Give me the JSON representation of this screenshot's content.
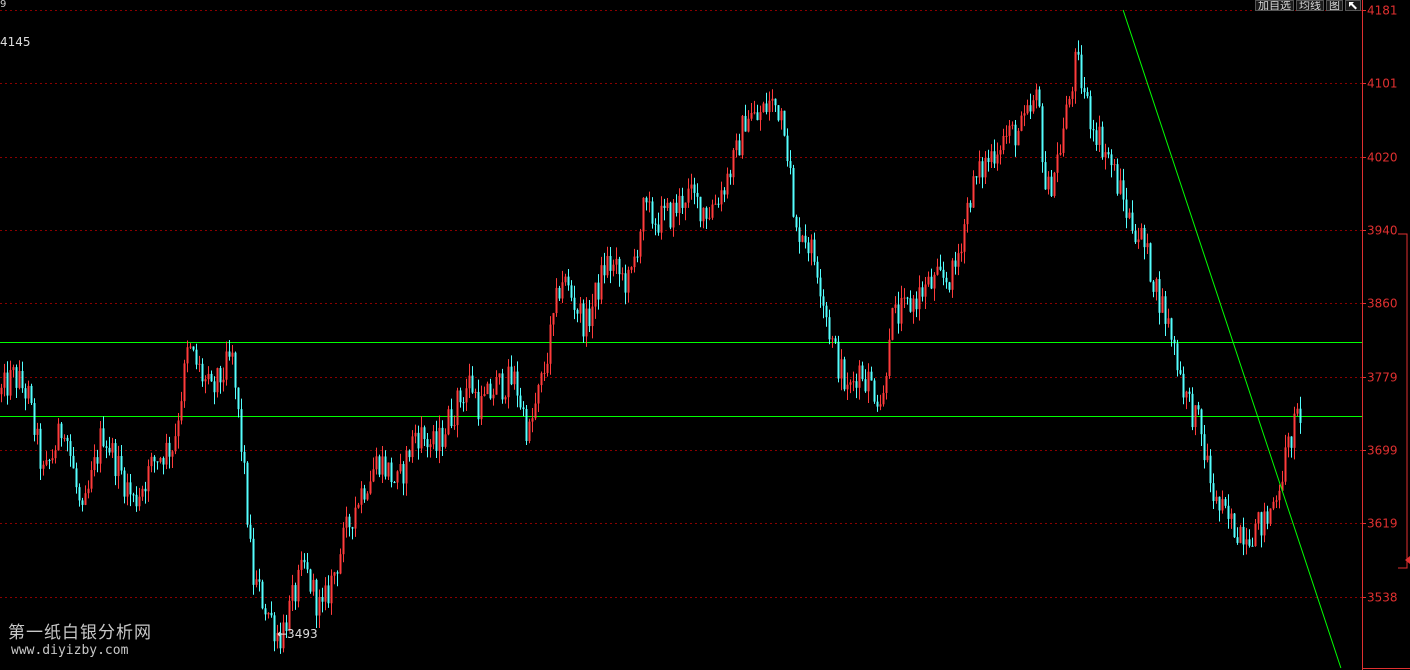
{
  "toolbar": {
    "corner_mark": "9",
    "buttons": [
      {
        "label": "加自选",
        "icon": ""
      },
      {
        "label": "均线",
        "icon": ""
      },
      {
        "label": "图",
        "icon": ""
      },
      {
        "label": "",
        "icon": "arrow-up-left-icon"
      }
    ]
  },
  "annotations": {
    "high_label": "4145",
    "low_label": "←3493"
  },
  "watermark": {
    "name": "第一纸白银分析网",
    "url": "www.diyizby.com"
  },
  "colors": {
    "background": "#000000",
    "up_candle": "#ff3b3b",
    "down_candle": "#54ffff",
    "grid": "#8a0000",
    "axis": "#e03030",
    "trendline": "#00ff00"
  },
  "chart_data": {
    "type": "candlestick",
    "title": "",
    "xlabel": "",
    "ylabel": "",
    "ylim": [
      3460,
      4181
    ],
    "y_ticks": [
      4181,
      4101,
      4020,
      3940,
      3860,
      3779,
      3699,
      3619,
      3538
    ],
    "grid": "horizontal dashed",
    "marked_high": 4145,
    "marked_low": 3493,
    "horizontal_lines": [
      3817,
      3736
    ],
    "trendline": {
      "start": {
        "x_index": 0.8246,
        "y": 4181
      },
      "end": {
        "x_index": 0.9845,
        "y": 3460
      }
    },
    "close_path": [
      [
        0.0,
        3760
      ],
      [
        0.01,
        3780
      ],
      [
        0.02,
        3760
      ],
      [
        0.032,
        3668
      ],
      [
        0.047,
        3730
      ],
      [
        0.06,
        3621
      ],
      [
        0.075,
        3720
      ],
      [
        0.098,
        3642
      ],
      [
        0.114,
        3690
      ],
      [
        0.127,
        3705
      ],
      [
        0.138,
        3810
      ],
      [
        0.155,
        3760
      ],
      [
        0.17,
        3800
      ],
      [
        0.178,
        3690
      ],
      [
        0.185,
        3560
      ],
      [
        0.205,
        3493
      ],
      [
        0.223,
        3570
      ],
      [
        0.236,
        3520
      ],
      [
        0.25,
        3590
      ],
      [
        0.262,
        3645
      ],
      [
        0.278,
        3690
      ],
      [
        0.292,
        3660
      ],
      [
        0.305,
        3720
      ],
      [
        0.32,
        3700
      ],
      [
        0.33,
        3735
      ],
      [
        0.345,
        3775
      ],
      [
        0.352,
        3745
      ],
      [
        0.365,
        3770
      ],
      [
        0.378,
        3775
      ],
      [
        0.388,
        3715
      ],
      [
        0.4,
        3790
      ],
      [
        0.412,
        3890
      ],
      [
        0.43,
        3835
      ],
      [
        0.445,
        3905
      ],
      [
        0.455,
        3890
      ],
      [
        0.462,
        3880
      ],
      [
        0.472,
        3960
      ],
      [
        0.482,
        3950
      ],
      [
        0.495,
        3960
      ],
      [
        0.503,
        3980
      ],
      [
        0.52,
        3960
      ],
      [
        0.53,
        3985
      ],
      [
        0.54,
        4020
      ],
      [
        0.548,
        4070
      ],
      [
        0.555,
        4060
      ],
      [
        0.565,
        4080
      ],
      [
        0.575,
        4070
      ],
      [
        0.58,
        4000
      ],
      [
        0.583,
        3930
      ],
      [
        0.588,
        3945
      ],
      [
        0.6,
        3900
      ],
      [
        0.61,
        3820
      ],
      [
        0.622,
        3760
      ],
      [
        0.63,
        3790
      ],
      [
        0.64,
        3770
      ],
      [
        0.648,
        3750
      ],
      [
        0.653,
        3840
      ],
      [
        0.663,
        3850
      ],
      [
        0.678,
        3875
      ],
      [
        0.69,
        3885
      ],
      [
        0.7,
        3890
      ],
      [
        0.712,
        3980
      ],
      [
        0.722,
        4010
      ],
      [
        0.735,
        4040
      ],
      [
        0.75,
        4050
      ],
      [
        0.762,
        4085
      ],
      [
        0.768,
        3975
      ],
      [
        0.778,
        4030
      ],
      [
        0.79,
        4125
      ],
      [
        0.8,
        4065
      ],
      [
        0.815,
        4015
      ],
      [
        0.828,
        3955
      ],
      [
        0.838,
        3930
      ],
      [
        0.848,
        3880
      ],
      [
        0.86,
        3825
      ],
      [
        0.87,
        3760
      ],
      [
        0.88,
        3725
      ],
      [
        0.892,
        3640
      ],
      [
        0.905,
        3615
      ],
      [
        0.918,
        3610
      ],
      [
        0.93,
        3620
      ],
      [
        0.94,
        3670
      ],
      [
        0.948,
        3715
      ],
      [
        0.955,
        3743
      ]
    ]
  }
}
